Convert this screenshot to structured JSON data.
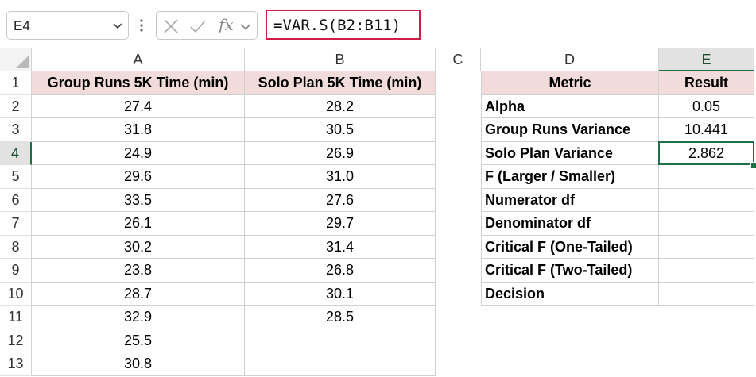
{
  "formula_bar": {
    "name_box": "E4",
    "fx_label": "fx",
    "formula": "=VAR.S(B2:B11)"
  },
  "columns": [
    "A",
    "B",
    "C",
    "D",
    "E"
  ],
  "rows": [
    "1",
    "2",
    "3",
    "4",
    "5",
    "6",
    "7",
    "8",
    "9",
    "10",
    "11",
    "12",
    "13"
  ],
  "sheet": {
    "header_a": "Group Runs 5K Time (min)",
    "header_b": "Solo Plan 5K Time (min)",
    "group_runs": [
      "27.4",
      "31.8",
      "24.9",
      "29.6",
      "33.5",
      "26.1",
      "30.2",
      "23.8",
      "28.7",
      "32.9",
      "25.5",
      "30.8"
    ],
    "solo_plan": [
      "28.2",
      "30.5",
      "26.9",
      "31.0",
      "27.6",
      "29.7",
      "31.4",
      "26.8",
      "30.1",
      "28.5"
    ],
    "metric_header": "Metric",
    "result_header": "Result",
    "metrics": [
      {
        "label": "Alpha",
        "value": "0.05"
      },
      {
        "label": "Group Runs Variance",
        "value": "10.441"
      },
      {
        "label": "Solo Plan Variance",
        "value": "2.862"
      },
      {
        "label": "F (Larger / Smaller)",
        "value": ""
      },
      {
        "label": "Numerator df",
        "value": ""
      },
      {
        "label": "Denominator df",
        "value": ""
      },
      {
        "label": "Critical F (One-Tailed)",
        "value": ""
      },
      {
        "label": "Critical F (Two-Tailed)",
        "value": ""
      },
      {
        "label": "Decision",
        "value": ""
      }
    ]
  },
  "selection": {
    "column": "E",
    "row": "4"
  },
  "colors": {
    "accent": "#1e7145",
    "header_fill": "#f2dcdb",
    "formula_border": "#d11e48"
  }
}
